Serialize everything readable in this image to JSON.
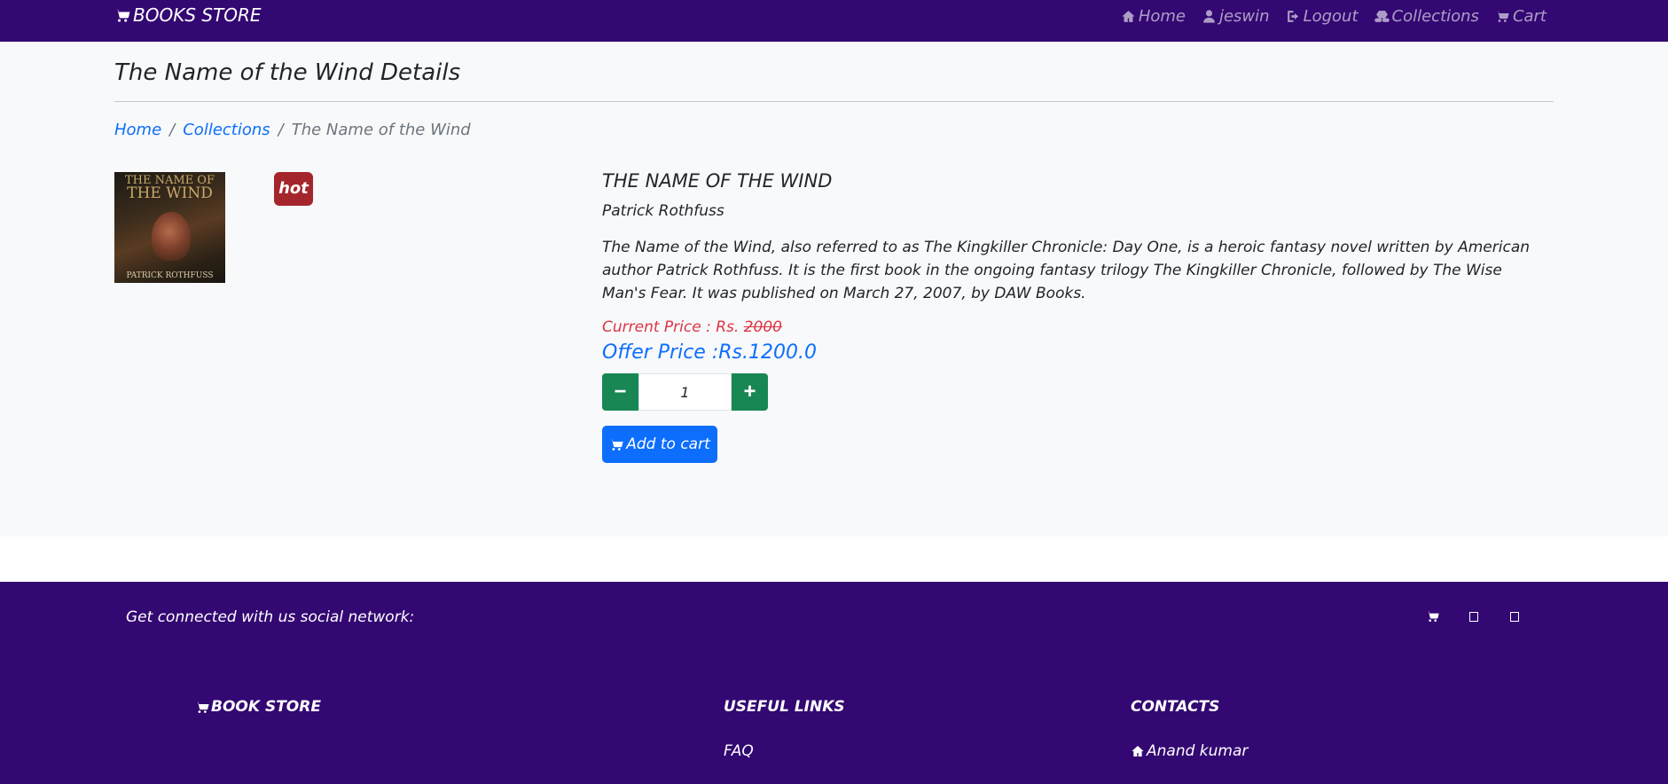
{
  "navbar": {
    "brand": "BOOKS STORE",
    "links": {
      "home": "Home",
      "user": "jeswin",
      "logout": "Logout",
      "collections": "Collections",
      "cart": "Cart"
    },
    "icons": [
      "cart-icon",
      "home-icon",
      "user-icon",
      "logout-icon",
      "collections-icon",
      "cart-icon"
    ]
  },
  "page": {
    "title": "The Name of the Wind Details"
  },
  "breadcrumb": {
    "home": "Home",
    "collections": "Collections",
    "current": "The Name of the Wind",
    "separator": "/"
  },
  "product": {
    "cover": {
      "title_line1": "THE NAME OF",
      "title_line2": "THE WIND",
      "author": "PATRICK ROTHFUSS"
    },
    "badge": "hot",
    "title": "THE NAME OF THE WIND",
    "author": "Patrick Rothfuss",
    "description": "The Name of the Wind, also referred to as The Kingkiller Chronicle: Day One, is a heroic fantasy novel written by American author Patrick Rothfuss. It is the first book in the ongoing fantasy trilogy The Kingkiller Chronicle, followed by The Wise Man's Fear. It was published on March 27, 2007, by DAW Books.",
    "current_price_label": "Current Price : Rs.",
    "current_price": "2000",
    "offer_price": "Offer Price :Rs.1200.0",
    "quantity": "1",
    "minus_label": "−",
    "plus_label": "+",
    "add_to_cart": "Add to cart"
  },
  "footer": {
    "social_text": "Get connected with us social network:",
    "brand": "BOOK STORE",
    "useful_links_heading": "USEFUL LINKS",
    "contacts_heading": "CONTACTS",
    "faq": "FAQ",
    "contact_name": "Anand kumar"
  },
  "colors": {
    "navbar_bg": "#330872",
    "main_bg": "#f8f9fa",
    "link": "#0d6efd",
    "price_red": "#dc3545",
    "qty_green": "#198754",
    "badge_red": "#a4262c"
  }
}
